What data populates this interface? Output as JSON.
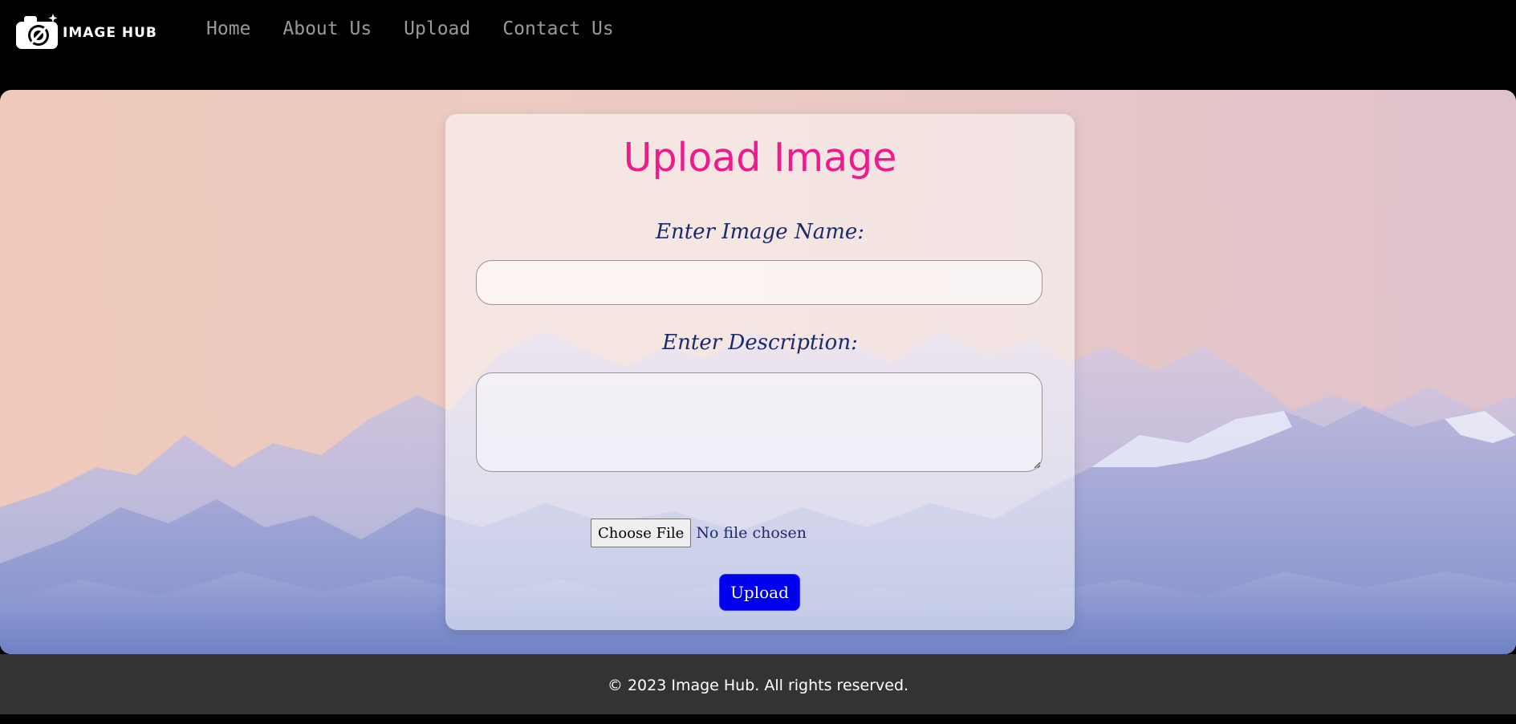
{
  "header": {
    "logo_text": "IMAGE HUB",
    "nav": [
      "Home",
      "About Us",
      "Upload",
      "Contact Us"
    ]
  },
  "form": {
    "title": "Upload Image",
    "name_label": "Enter Image Name:",
    "name_value": "",
    "description_label": "Enter Description:",
    "description_value": "",
    "choose_file_label": "Choose File",
    "file_status": "No file chosen",
    "submit_label": "Upload"
  },
  "footer": {
    "text": "© 2023 Image Hub. All rights reserved."
  },
  "colors": {
    "title": "#ee1b8e",
    "label": "#1b2a6a",
    "button": "#0000ee",
    "footer_bg": "#333333"
  },
  "icons": [
    "camera-logo-icon",
    "resize-grip-icon"
  ]
}
